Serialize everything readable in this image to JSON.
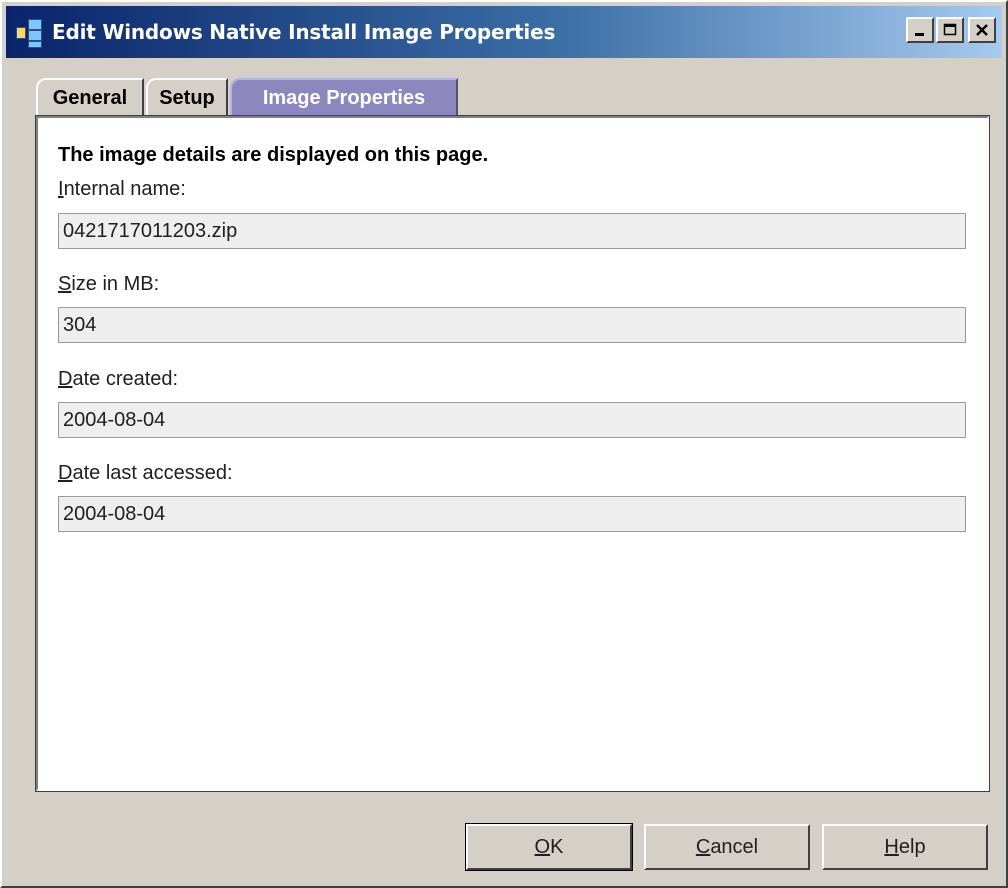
{
  "window": {
    "title": "Edit Windows Native Install Image Properties",
    "title_color": "#ffffff",
    "titlebar_gradient": [
      "#0a246a",
      "#a6caf0"
    ]
  },
  "tabs": [
    {
      "label": "General",
      "active": false
    },
    {
      "label": "Setup",
      "active": false
    },
    {
      "label": "Image Properties",
      "active": true
    }
  ],
  "panel": {
    "heading": "The image details are displayed on this page.",
    "fields": [
      {
        "label_first": "I",
        "label_rest": "nternal name:",
        "value": "0421717011203.zip"
      },
      {
        "label_first": "S",
        "label_rest": "ize in MB:",
        "value": "304"
      },
      {
        "label_first": "D",
        "label_rest": "ate created:",
        "value": "2004-08-04"
      },
      {
        "label_first": "D",
        "label_rest": "ate last accessed:",
        "value": "2004-08-04"
      }
    ]
  },
  "buttons": {
    "ok": {
      "mnemonic": "O",
      "rest": "K"
    },
    "cancel": {
      "mnemonic": "C",
      "rest": "ancel"
    },
    "help": {
      "mnemonic": "H",
      "rest": "elp"
    }
  },
  "colors": {
    "active_tab": "#8d87bf",
    "dialog_bg": "#d4d0c8",
    "field_bg": "#eeeeee"
  }
}
